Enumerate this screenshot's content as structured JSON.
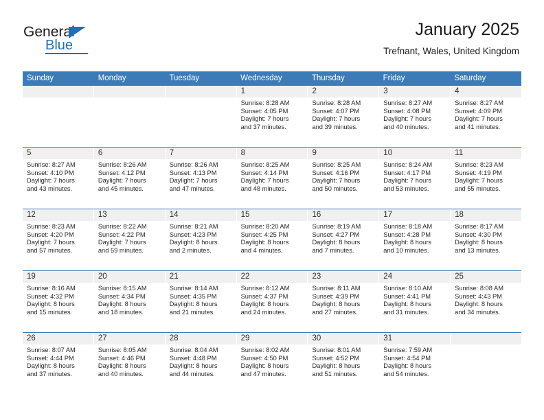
{
  "brand": {
    "name_top": "General",
    "name_bottom": "Blue",
    "accent_color": "#1f6fb5"
  },
  "header": {
    "title": "January 2025",
    "subtitle": "Trefnant, Wales, United Kingdom"
  },
  "calendar": {
    "header_bg": "#3b7cb8",
    "weekdays": [
      "Sunday",
      "Monday",
      "Tuesday",
      "Wednesday",
      "Thursday",
      "Friday",
      "Saturday"
    ],
    "labels": {
      "sunrise": "Sunrise:",
      "sunset": "Sunset:",
      "daylight": "Daylight:"
    },
    "weeks": [
      [
        {
          "day": ""
        },
        {
          "day": ""
        },
        {
          "day": ""
        },
        {
          "day": "1",
          "sunrise": "Sunrise: 8:28 AM",
          "sunset": "Sunset: 4:05 PM",
          "daylight_1": "Daylight: 7 hours",
          "daylight_2": "and 37 minutes."
        },
        {
          "day": "2",
          "sunrise": "Sunrise: 8:28 AM",
          "sunset": "Sunset: 4:07 PM",
          "daylight_1": "Daylight: 7 hours",
          "daylight_2": "and 39 minutes."
        },
        {
          "day": "3",
          "sunrise": "Sunrise: 8:27 AM",
          "sunset": "Sunset: 4:08 PM",
          "daylight_1": "Daylight: 7 hours",
          "daylight_2": "and 40 minutes."
        },
        {
          "day": "4",
          "sunrise": "Sunrise: 8:27 AM",
          "sunset": "Sunset: 4:09 PM",
          "daylight_1": "Daylight: 7 hours",
          "daylight_2": "and 41 minutes."
        }
      ],
      [
        {
          "day": "5",
          "sunrise": "Sunrise: 8:27 AM",
          "sunset": "Sunset: 4:10 PM",
          "daylight_1": "Daylight: 7 hours",
          "daylight_2": "and 43 minutes."
        },
        {
          "day": "6",
          "sunrise": "Sunrise: 8:26 AM",
          "sunset": "Sunset: 4:12 PM",
          "daylight_1": "Daylight: 7 hours",
          "daylight_2": "and 45 minutes."
        },
        {
          "day": "7",
          "sunrise": "Sunrise: 8:26 AM",
          "sunset": "Sunset: 4:13 PM",
          "daylight_1": "Daylight: 7 hours",
          "daylight_2": "and 47 minutes."
        },
        {
          "day": "8",
          "sunrise": "Sunrise: 8:25 AM",
          "sunset": "Sunset: 4:14 PM",
          "daylight_1": "Daylight: 7 hours",
          "daylight_2": "and 48 minutes."
        },
        {
          "day": "9",
          "sunrise": "Sunrise: 8:25 AM",
          "sunset": "Sunset: 4:16 PM",
          "daylight_1": "Daylight: 7 hours",
          "daylight_2": "and 50 minutes."
        },
        {
          "day": "10",
          "sunrise": "Sunrise: 8:24 AM",
          "sunset": "Sunset: 4:17 PM",
          "daylight_1": "Daylight: 7 hours",
          "daylight_2": "and 53 minutes."
        },
        {
          "day": "11",
          "sunrise": "Sunrise: 8:23 AM",
          "sunset": "Sunset: 4:19 PM",
          "daylight_1": "Daylight: 7 hours",
          "daylight_2": "and 55 minutes."
        }
      ],
      [
        {
          "day": "12",
          "sunrise": "Sunrise: 8:23 AM",
          "sunset": "Sunset: 4:20 PM",
          "daylight_1": "Daylight: 7 hours",
          "daylight_2": "and 57 minutes."
        },
        {
          "day": "13",
          "sunrise": "Sunrise: 8:22 AM",
          "sunset": "Sunset: 4:22 PM",
          "daylight_1": "Daylight: 7 hours",
          "daylight_2": "and 59 minutes."
        },
        {
          "day": "14",
          "sunrise": "Sunrise: 8:21 AM",
          "sunset": "Sunset: 4:23 PM",
          "daylight_1": "Daylight: 8 hours",
          "daylight_2": "and 2 minutes."
        },
        {
          "day": "15",
          "sunrise": "Sunrise: 8:20 AM",
          "sunset": "Sunset: 4:25 PM",
          "daylight_1": "Daylight: 8 hours",
          "daylight_2": "and 4 minutes."
        },
        {
          "day": "16",
          "sunrise": "Sunrise: 8:19 AM",
          "sunset": "Sunset: 4:27 PM",
          "daylight_1": "Daylight: 8 hours",
          "daylight_2": "and 7 minutes."
        },
        {
          "day": "17",
          "sunrise": "Sunrise: 8:18 AM",
          "sunset": "Sunset: 4:28 PM",
          "daylight_1": "Daylight: 8 hours",
          "daylight_2": "and 10 minutes."
        },
        {
          "day": "18",
          "sunrise": "Sunrise: 8:17 AM",
          "sunset": "Sunset: 4:30 PM",
          "daylight_1": "Daylight: 8 hours",
          "daylight_2": "and 13 minutes."
        }
      ],
      [
        {
          "day": "19",
          "sunrise": "Sunrise: 8:16 AM",
          "sunset": "Sunset: 4:32 PM",
          "daylight_1": "Daylight: 8 hours",
          "daylight_2": "and 15 minutes."
        },
        {
          "day": "20",
          "sunrise": "Sunrise: 8:15 AM",
          "sunset": "Sunset: 4:34 PM",
          "daylight_1": "Daylight: 8 hours",
          "daylight_2": "and 18 minutes."
        },
        {
          "day": "21",
          "sunrise": "Sunrise: 8:14 AM",
          "sunset": "Sunset: 4:35 PM",
          "daylight_1": "Daylight: 8 hours",
          "daylight_2": "and 21 minutes."
        },
        {
          "day": "22",
          "sunrise": "Sunrise: 8:12 AM",
          "sunset": "Sunset: 4:37 PM",
          "daylight_1": "Daylight: 8 hours",
          "daylight_2": "and 24 minutes."
        },
        {
          "day": "23",
          "sunrise": "Sunrise: 8:11 AM",
          "sunset": "Sunset: 4:39 PM",
          "daylight_1": "Daylight: 8 hours",
          "daylight_2": "and 27 minutes."
        },
        {
          "day": "24",
          "sunrise": "Sunrise: 8:10 AM",
          "sunset": "Sunset: 4:41 PM",
          "daylight_1": "Daylight: 8 hours",
          "daylight_2": "and 31 minutes."
        },
        {
          "day": "25",
          "sunrise": "Sunrise: 8:08 AM",
          "sunset": "Sunset: 4:43 PM",
          "daylight_1": "Daylight: 8 hours",
          "daylight_2": "and 34 minutes."
        }
      ],
      [
        {
          "day": "26",
          "sunrise": "Sunrise: 8:07 AM",
          "sunset": "Sunset: 4:44 PM",
          "daylight_1": "Daylight: 8 hours",
          "daylight_2": "and 37 minutes."
        },
        {
          "day": "27",
          "sunrise": "Sunrise: 8:05 AM",
          "sunset": "Sunset: 4:46 PM",
          "daylight_1": "Daylight: 8 hours",
          "daylight_2": "and 40 minutes."
        },
        {
          "day": "28",
          "sunrise": "Sunrise: 8:04 AM",
          "sunset": "Sunset: 4:48 PM",
          "daylight_1": "Daylight: 8 hours",
          "daylight_2": "and 44 minutes."
        },
        {
          "day": "29",
          "sunrise": "Sunrise: 8:02 AM",
          "sunset": "Sunset: 4:50 PM",
          "daylight_1": "Daylight: 8 hours",
          "daylight_2": "and 47 minutes."
        },
        {
          "day": "30",
          "sunrise": "Sunrise: 8:01 AM",
          "sunset": "Sunset: 4:52 PM",
          "daylight_1": "Daylight: 8 hours",
          "daylight_2": "and 51 minutes."
        },
        {
          "day": "31",
          "sunrise": "Sunrise: 7:59 AM",
          "sunset": "Sunset: 4:54 PM",
          "daylight_1": "Daylight: 8 hours",
          "daylight_2": "and 54 minutes."
        },
        {
          "day": ""
        }
      ]
    ]
  }
}
